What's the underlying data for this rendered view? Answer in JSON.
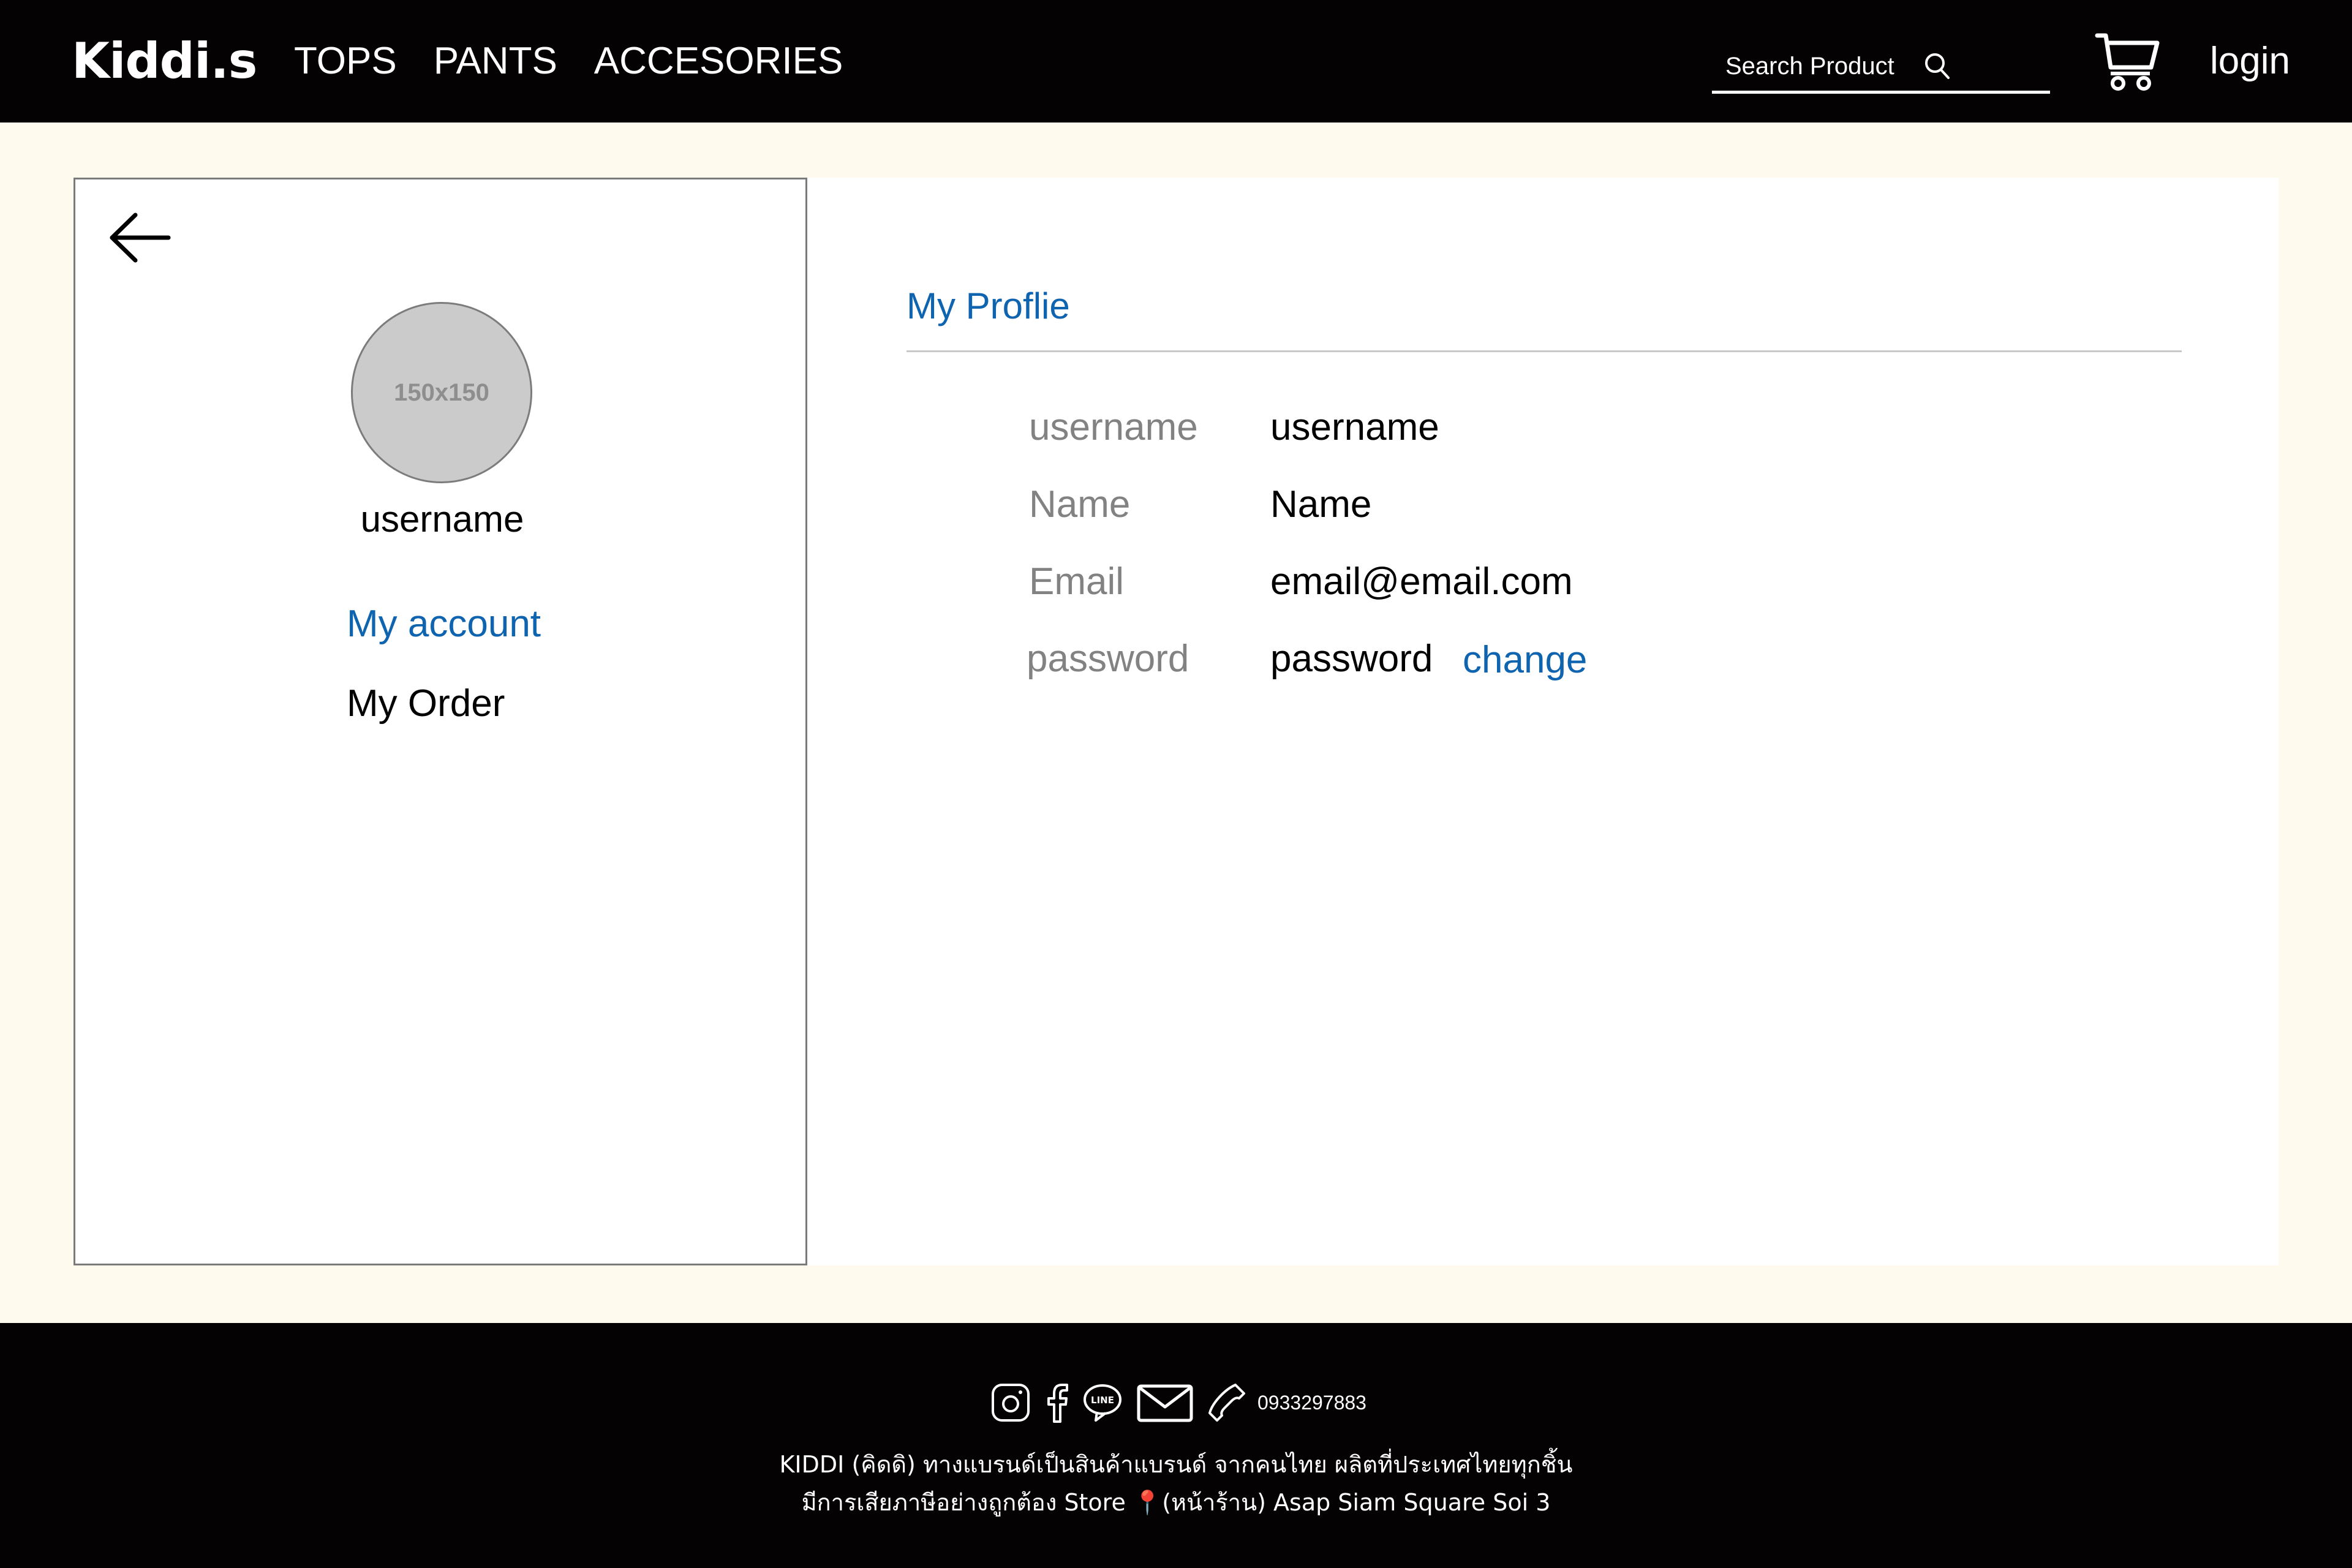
{
  "header": {
    "logo": "Kiddi.s",
    "nav": [
      "TOPS",
      "PANTS",
      "ACCESORIES"
    ],
    "search_placeholder": "Search Product",
    "login_label": "login"
  },
  "sidebar": {
    "avatar_placeholder": "150x150",
    "username": "username",
    "menu": {
      "my_account": "My account",
      "my_order": "My Order"
    }
  },
  "profile": {
    "title": "My Proflie",
    "rows": [
      {
        "label": "username",
        "value": "username"
      },
      {
        "label": "Name",
        "value": "Name"
      },
      {
        "label": "Email",
        "value": "email@email.com"
      },
      {
        "label": "password",
        "value": "password"
      }
    ],
    "change_label": "change"
  },
  "footer": {
    "phone": "0933297883",
    "line1": "KIDDI (คิดดิ) ทางแบรนด์เป็นสินค้าแบรนด์ จากคนไทย ผลิตที่ประเทศไทยทุกชิ้น",
    "line2": "มีการเสียภาษีอย่างถูกต้อง Store 📍(หน้าร้าน) Asap Siam Square Soi 3",
    "icons": [
      "instagram-icon",
      "facebook-icon",
      "line-icon",
      "mail-icon",
      "phone-icon"
    ]
  },
  "colors": {
    "header_bg": "#040203",
    "page_bg": "#fffaee",
    "accent": "#0f64b0"
  }
}
